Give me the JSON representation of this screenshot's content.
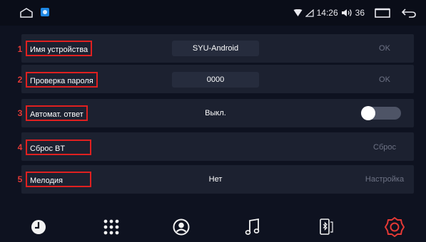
{
  "status_bar": {
    "time": "14:26",
    "volume": "36",
    "home_icon": "home-outline-icon",
    "app_icon": "app-notification-icon",
    "wifi_icon": "wifi-icon",
    "signal_icon": "signal-icon",
    "volume_icon": "speaker-icon",
    "window_icon": "recent-apps-icon",
    "back_icon": "back-arrow-icon"
  },
  "settings": [
    {
      "num": "1",
      "label": "Имя устройства",
      "value": "SYU-Android",
      "action": "OK"
    },
    {
      "num": "2",
      "label": "Проверка пароля",
      "value": "0000",
      "action": "OK"
    },
    {
      "num": "3",
      "label": "Автомат. ответ",
      "value": "Выкл.",
      "action": ""
    },
    {
      "num": "4",
      "label": "Сброс BT",
      "value": "",
      "action": "Сброс"
    },
    {
      "num": "5",
      "label": "Мелодия",
      "value": "Нет",
      "action": "Настройка"
    }
  ],
  "auto_answer_toggle": {
    "state": "off"
  },
  "dock": [
    {
      "icon": "recent-calls-icon"
    },
    {
      "icon": "dialpad-icon"
    },
    {
      "icon": "contacts-icon"
    },
    {
      "icon": "music-icon"
    },
    {
      "icon": "phone-bluetooth-icon"
    },
    {
      "icon": "settings-gear-icon",
      "active": true
    }
  ],
  "colors": {
    "accent": "#e53935",
    "panel": "#1c2130",
    "background": "#0e1220"
  }
}
